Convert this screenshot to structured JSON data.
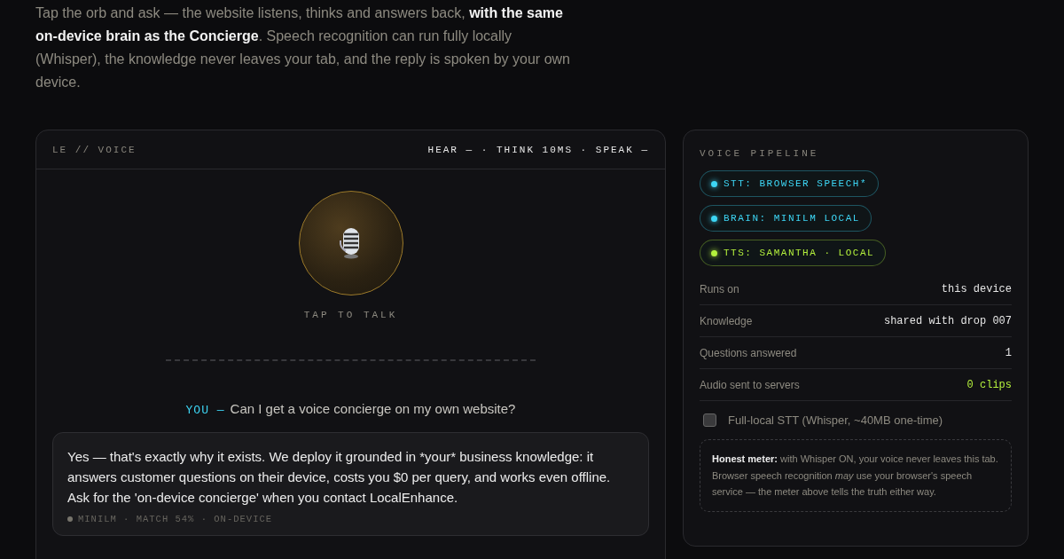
{
  "intro": "Tap the orb and ask — the website listens, thinks and answers back, **with the same on-device brain as the Concierge**. Speech recognition can run fully locally (Whisper), the knowledge never leaves your tab, and the reply is spoken by your own device.",
  "voice_card": {
    "brand": "LE // VOICE",
    "status": "HEAR — · THINK 10MS · SPEAK —",
    "orb_label": "TAP TO TALK",
    "question_label": "YOU —",
    "question": "Can I get a voice concierge on my own website?",
    "reply": {
      "text": "Yes — that's exactly why it exists. We deploy it grounded in *your* business knowledge: it answers customer questions on their device, costs you $0 per query, and works even offline. Ask for the 'on-device concierge' when you contact LocalEnhance.",
      "meta": "MINILM · MATCH 54% · ON-DEVICE"
    }
  },
  "pipeline": {
    "title": "VOICE PIPELINE",
    "chips": [
      {
        "label": "STT: BROWSER SPEECH*",
        "color": "#3dd6f5"
      },
      {
        "label": "BRAIN: MINILM LOCAL",
        "color": "#3dd6f5"
      },
      {
        "label": "TTS: SAMANTHA · LOCAL",
        "color": "#b5f23d"
      }
    ],
    "stats": [
      {
        "label": "Runs on",
        "value": "this device",
        "highlight": false
      },
      {
        "label": "Knowledge",
        "value": "shared with drop 007",
        "highlight": false
      },
      {
        "label": "Questions answered",
        "value": "1",
        "highlight": false
      },
      {
        "label": "Audio sent to servers",
        "value": "0 clips",
        "highlight": true
      }
    ],
    "whisper_option": {
      "label": "Full-local STT (Whisper, ~40MB one-time)",
      "checked": false
    },
    "note": "**Honest meter:** with Whisper ON, your voice never leaves this tab. Browser speech recognition *may* use your browser's speech service — the meter above tells the truth either way."
  }
}
